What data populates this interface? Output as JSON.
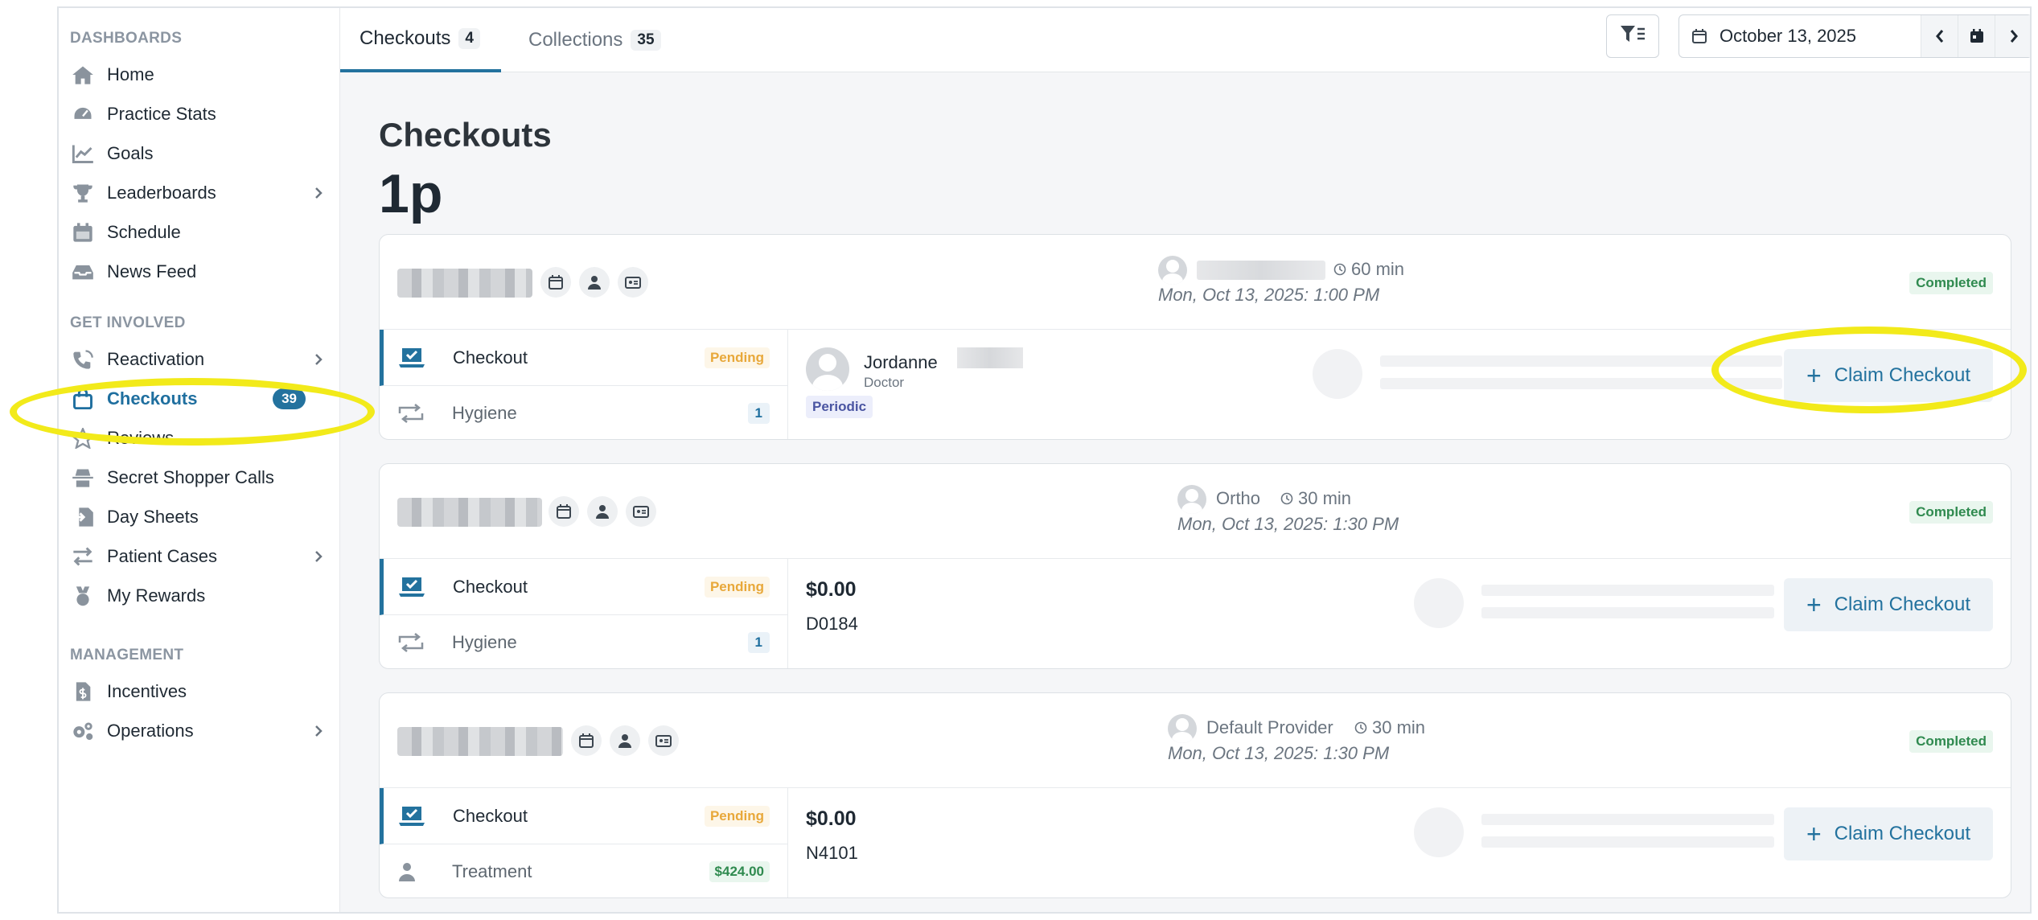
{
  "sidebar": {
    "sections": {
      "dashboards": "DASHBOARDS",
      "get_involved": "GET INVOLVED",
      "management": "MANAGEMENT"
    },
    "items": {
      "home": "Home",
      "practice_stats": "Practice Stats",
      "goals": "Goals",
      "leaderboards": "Leaderboards",
      "schedule": "Schedule",
      "news_feed": "News Feed",
      "reactivation": "Reactivation",
      "checkouts": "Checkouts",
      "checkouts_badge": "39",
      "reviews": "Reviews",
      "secret_shopper": "Secret Shopper Calls",
      "day_sheets": "Day Sheets",
      "patient_cases": "Patient Cases",
      "my_rewards": "My Rewards",
      "incentives": "Incentives",
      "operations": "Operations"
    }
  },
  "topbar": {
    "tabs": [
      {
        "label": "Checkouts",
        "count": "4"
      },
      {
        "label": "Collections",
        "count": "35"
      }
    ],
    "date": "October 13, 2025"
  },
  "main": {
    "title": "Checkouts",
    "subtitle": "1p",
    "cards": [
      {
        "provider": "",
        "duration": "60 min",
        "time": "Mon, Oct 13, 2025: 1:00 PM",
        "status": "Completed",
        "row1": {
          "label": "Checkout",
          "badge": "Pending"
        },
        "row2": {
          "label": "Hygiene",
          "badge": "1"
        },
        "doctor": {
          "name": "Jordanne",
          "role": "Doctor",
          "tag": "Periodic"
        },
        "claim": "Claim Checkout"
      },
      {
        "provider": "Ortho",
        "duration": "30 min",
        "time": "Mon, Oct 13, 2025: 1:30 PM",
        "status": "Completed",
        "row1": {
          "label": "Checkout",
          "badge": "Pending"
        },
        "row2": {
          "label": "Hygiene",
          "badge": "1"
        },
        "amount": "$0.00",
        "code": "D0184",
        "claim": "Claim Checkout"
      },
      {
        "provider": "Default Provider",
        "duration": "30 min",
        "time": "Mon, Oct 13, 2025: 1:30 PM",
        "status": "Completed",
        "row1": {
          "label": "Checkout",
          "badge": "Pending"
        },
        "row2": {
          "label": "Treatment",
          "badge": "$424.00"
        },
        "amount": "$0.00",
        "code": "N4101",
        "claim": "Claim Checkout"
      }
    ]
  },
  "colors": {
    "accent": "#23729e",
    "pending": "#e8a83a",
    "completed": "#2f8a4f",
    "annotation": "#f2ea1a"
  }
}
